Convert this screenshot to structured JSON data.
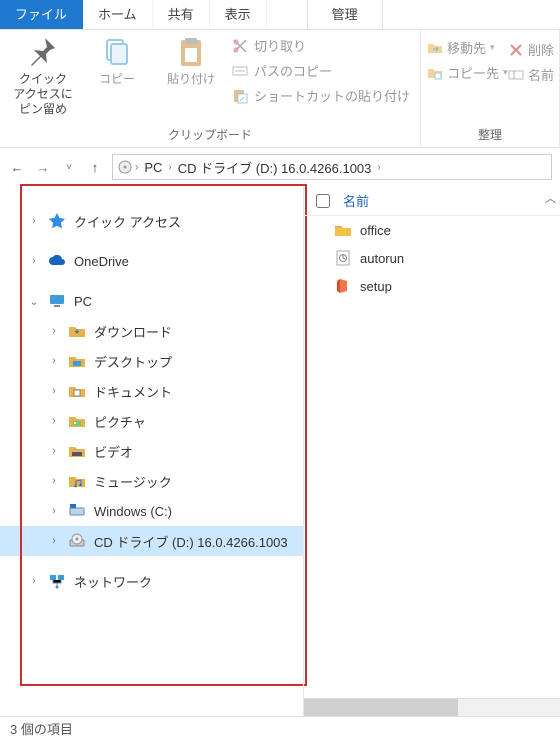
{
  "tabs": {
    "file": "ファイル",
    "home": "ホーム",
    "share": "共有",
    "view": "表示",
    "manage": "管理"
  },
  "ribbon": {
    "pin_label": "クイック アクセスにピン留め",
    "copy_label": "コピー",
    "paste_label": "貼り付け",
    "cut": "切り取り",
    "copy_path": "パスのコピー",
    "paste_shortcut": "ショートカットの貼り付け",
    "group_clipboard": "クリップボード",
    "move_to": "移動先",
    "copy_to": "コピー先",
    "delete": "削除",
    "rename": "名前",
    "group_organize": "整理"
  },
  "breadcrumb": {
    "pc": "PC",
    "drive": "CD ドライブ (D:) 16.0.4266.1003"
  },
  "tree": {
    "quick_access": "クイック アクセス",
    "onedrive": "OneDrive",
    "pc": "PC",
    "downloads": "ダウンロード",
    "desktop": "デスクトップ",
    "documents": "ドキュメント",
    "pictures": "ピクチャ",
    "videos": "ビデオ",
    "music": "ミュージック",
    "c_drive": "Windows (C:)",
    "d_drive": "CD ドライブ (D:) 16.0.4266.1003",
    "network": "ネットワーク"
  },
  "columns": {
    "name": "名前"
  },
  "files": {
    "office": "office",
    "autorun": "autorun",
    "setup": "setup"
  },
  "status": {
    "item_count": "3 個の項目"
  }
}
